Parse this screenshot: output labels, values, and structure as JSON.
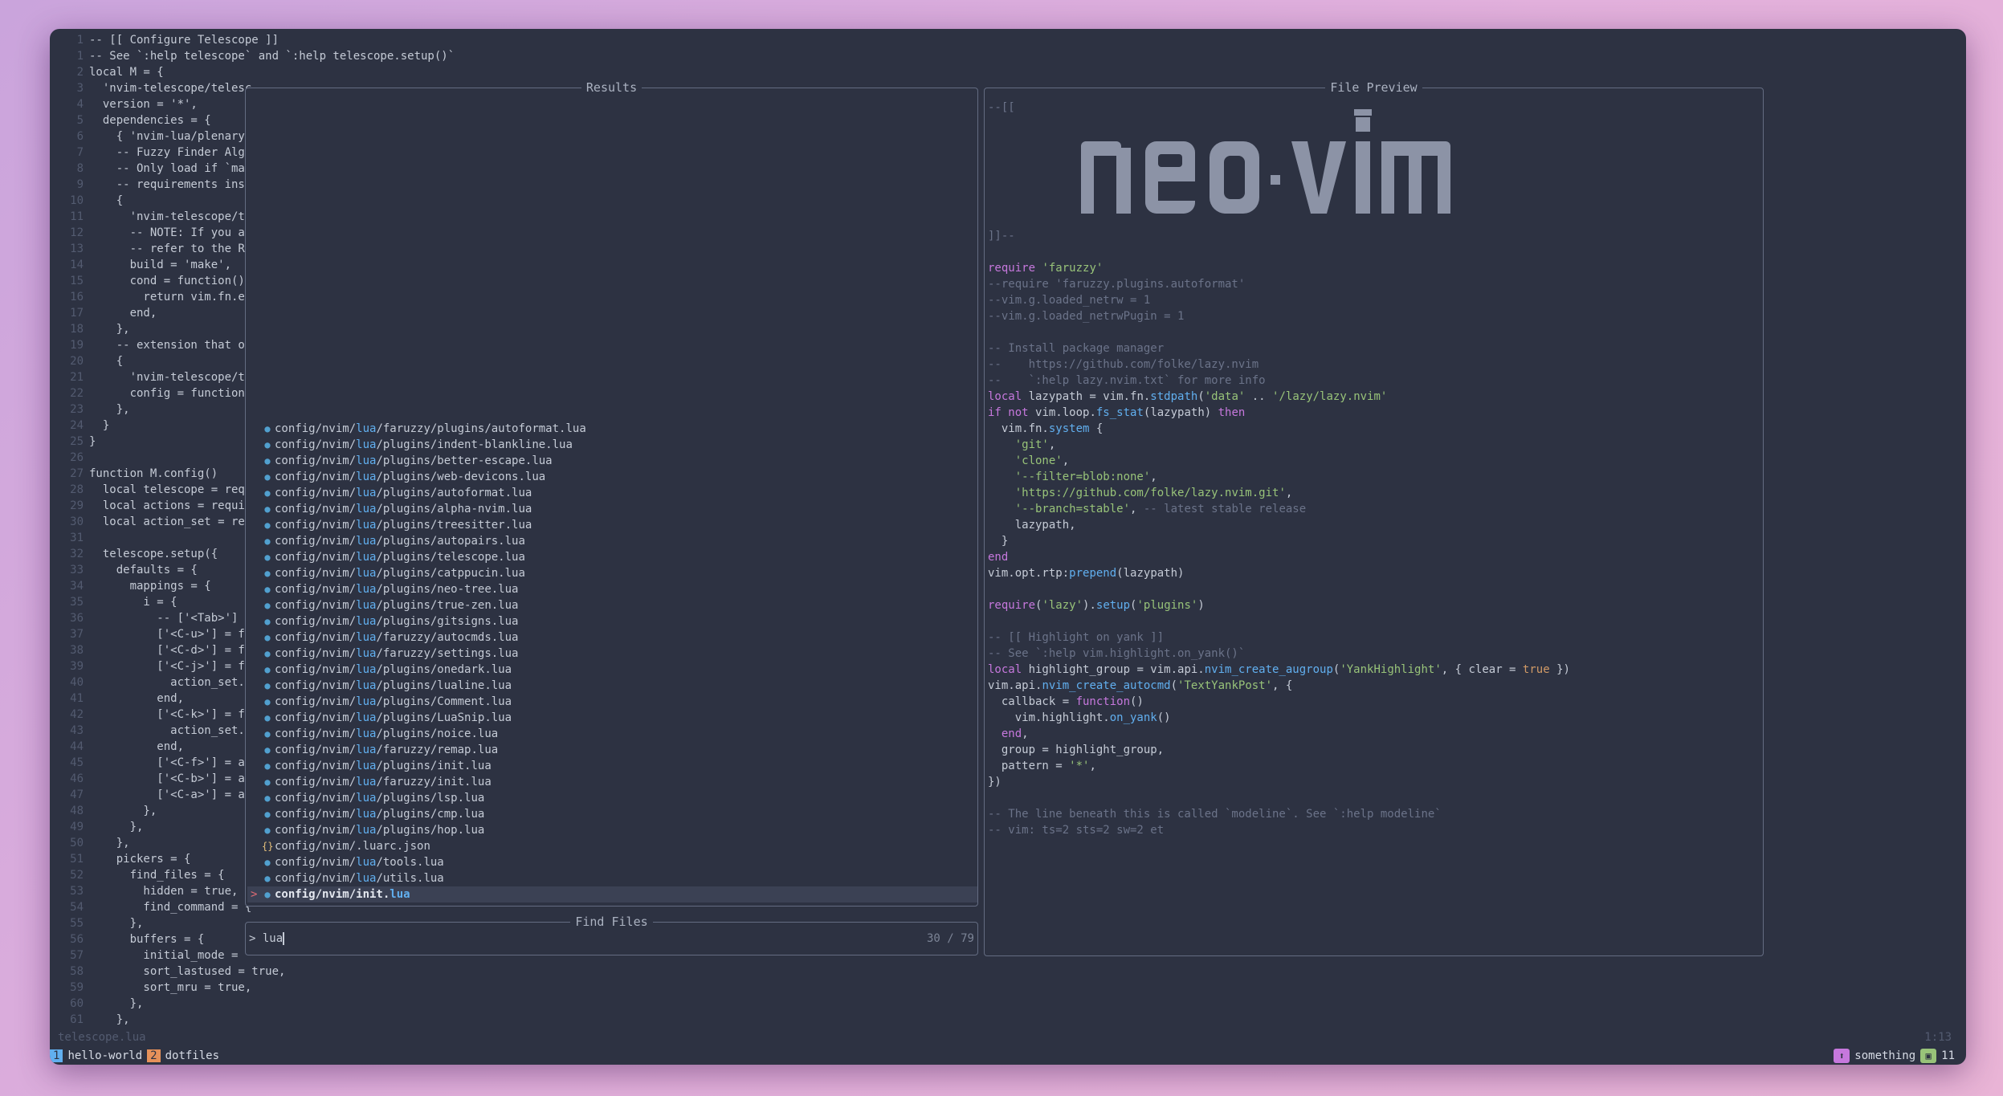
{
  "editor": {
    "file_name": "telescope.lua",
    "cursor_pos": "1:13",
    "line_numbers": "1\n1\n2\n3\n4\n5\n6\n7\n8\n9\n10\n11\n12\n13\n14\n15\n16\n17\n18\n19\n20\n21\n22\n23\n24\n25\n26\n27\n28\n29\n30\n31\n32\n33\n34\n35\n36\n37\n38\n39\n40\n41\n42\n43\n44\n45\n46\n47\n48\n49\n50\n51\n52\n53\n54\n55\n56\n57\n58\n59\n60\n61",
    "code": "-- [[ Configure Telescope ]]\n-- See `:help telescope` and `:help telescope.setup()`\nlocal M = {\n  'nvim-telescope/telesc\n  version = '*',\n  dependencies = {\n    { 'nvim-lua/plenary.\n    -- Fuzzy Finder Algo\n    -- Only load if `mak\n    -- requirements inst\n    {\n      'nvim-telescope/te\n      -- NOTE: If you ar\n      -- refer to the RE\n      build = 'make',\n      cond = function()\n        return vim.fn.ex\n      end,\n    },\n    -- extension that of\n    {\n      'nvim-telescope/te\n      config = function(\n    },\n  }\n}\n\nfunction M.config()\n  local telescope = requ\n  local actions = requir\n  local action_set = req\n\n  telescope.setup({\n    defaults = {\n      mappings = {\n        i = {\n          -- ['<Tab>'] =\n          ['<C-u>'] = fa\n          ['<C-d>'] = fa\n          ['<C-j>'] = fu\n            action_set.s\n          end,\n          ['<C-k>'] = fu\n            action_set.s\n          end,\n          ['<C-f>'] = ac\n          ['<C-b>'] = ac\n          ['<C-a>'] = ac\n        },\n      },\n    },\n    pickers = {\n      find_files = {\n        hidden = true,\n        find_command = {\n      },\n      buffers = {\n        initial_mode = '\n        sort_lastused = true,\n        sort_mru = true,\n      },\n    },"
  },
  "results": {
    "title": "Results",
    "items": [
      {
        "pre": "config/nvim/",
        "mid": "lua",
        "post": "/faruzzy/plugins/autoformat.lua",
        "icon": "lua"
      },
      {
        "pre": "config/nvim/",
        "mid": "lua",
        "post": "/plugins/indent-blankline.lua",
        "icon": "lua"
      },
      {
        "pre": "config/nvim/",
        "mid": "lua",
        "post": "/plugins/better-escape.lua",
        "icon": "lua"
      },
      {
        "pre": "config/nvim/",
        "mid": "lua",
        "post": "/plugins/web-devicons.lua",
        "icon": "lua"
      },
      {
        "pre": "config/nvim/",
        "mid": "lua",
        "post": "/plugins/autoformat.lua",
        "icon": "lua"
      },
      {
        "pre": "config/nvim/",
        "mid": "lua",
        "post": "/plugins/alpha-nvim.lua",
        "icon": "lua"
      },
      {
        "pre": "config/nvim/",
        "mid": "lua",
        "post": "/plugins/treesitter.lua",
        "icon": "lua"
      },
      {
        "pre": "config/nvim/",
        "mid": "lua",
        "post": "/plugins/autopairs.lua",
        "icon": "lua"
      },
      {
        "pre": "config/nvim/",
        "mid": "lua",
        "post": "/plugins/telescope.lua",
        "icon": "lua"
      },
      {
        "pre": "config/nvim/",
        "mid": "lua",
        "post": "/plugins/catppucin.lua",
        "icon": "lua"
      },
      {
        "pre": "config/nvim/",
        "mid": "lua",
        "post": "/plugins/neo-tree.lua",
        "icon": "lua"
      },
      {
        "pre": "config/nvim/",
        "mid": "lua",
        "post": "/plugins/true-zen.lua",
        "icon": "lua"
      },
      {
        "pre": "config/nvim/",
        "mid": "lua",
        "post": "/plugins/gitsigns.lua",
        "icon": "lua"
      },
      {
        "pre": "config/nvim/",
        "mid": "lua",
        "post": "/faruzzy/autocmds.lua",
        "icon": "lua"
      },
      {
        "pre": "config/nvim/",
        "mid": "lua",
        "post": "/faruzzy/settings.lua",
        "icon": "lua"
      },
      {
        "pre": "config/nvim/",
        "mid": "lua",
        "post": "/plugins/onedark.lua",
        "icon": "lua"
      },
      {
        "pre": "config/nvim/",
        "mid": "lua",
        "post": "/plugins/lualine.lua",
        "icon": "lua"
      },
      {
        "pre": "config/nvim/",
        "mid": "lua",
        "post": "/plugins/Comment.lua",
        "icon": "lua"
      },
      {
        "pre": "config/nvim/",
        "mid": "lua",
        "post": "/plugins/LuaSnip.lua",
        "icon": "lua"
      },
      {
        "pre": "config/nvim/",
        "mid": "lua",
        "post": "/plugins/noice.lua",
        "icon": "lua"
      },
      {
        "pre": "config/nvim/",
        "mid": "lua",
        "post": "/faruzzy/remap.lua",
        "icon": "lua"
      },
      {
        "pre": "config/nvim/",
        "mid": "lua",
        "post": "/plugins/init.lua",
        "icon": "lua"
      },
      {
        "pre": "config/nvim/",
        "mid": "lua",
        "post": "/faruzzy/init.lua",
        "icon": "lua"
      },
      {
        "pre": "config/nvim/",
        "mid": "lua",
        "post": "/plugins/lsp.lua",
        "icon": "lua"
      },
      {
        "pre": "config/nvim/",
        "mid": "lua",
        "post": "/plugins/cmp.lua",
        "icon": "lua"
      },
      {
        "pre": "config/nvim/",
        "mid": "lua",
        "post": "/plugins/hop.lua",
        "icon": "lua"
      },
      {
        "pre": "config/nvim/",
        "mid": "",
        "post": ".luarc.json",
        "icon": "json"
      },
      {
        "pre": "config/nvim/",
        "mid": "lua",
        "post": "/tools.lua",
        "icon": "lua"
      },
      {
        "pre": "config/nvim/",
        "mid": "lua",
        "post": "/utils.lua",
        "icon": "lua"
      },
      {
        "pre": "config/nvim/init.",
        "mid": "lua",
        "post": "",
        "icon": "lua",
        "selected": true
      }
    ]
  },
  "finder": {
    "title": "Find Files",
    "prompt_symbol": ">",
    "query": "lua",
    "count": "30 / 79"
  },
  "preview": {
    "title": "File Preview",
    "logo_text": "neovim",
    "lines": [
      [
        [
          "--[[",
          "cm"
        ]
      ],
      [],
      [],
      [],
      [],
      [],
      [],
      [],
      [
        [
          "]]--",
          "cm"
        ]
      ],
      [],
      [
        [
          "require ",
          "kw"
        ],
        [
          "'faruzzy'",
          "st"
        ]
      ],
      [
        [
          "--require 'faruzzy.plugins.autoformat'",
          "cm"
        ]
      ],
      [
        [
          "--vim.g.loaded_netrw = 1",
          "cm"
        ]
      ],
      [
        [
          "--vim.g.loaded_netrwPugin = 1",
          "cm"
        ]
      ],
      [],
      [
        [
          "-- Install package manager",
          "cm"
        ]
      ],
      [
        [
          "--    https://github.com/folke/lazy.nvim",
          "cm"
        ]
      ],
      [
        [
          "--    `:help lazy.nvim.txt` for more info",
          "cm"
        ]
      ],
      [
        [
          "local ",
          "kw"
        ],
        [
          "lazypath = vim.fn.",
          ""
        ],
        [
          "stdpath",
          "fn"
        ],
        [
          "(",
          ""
        ],
        [
          "'data'",
          "st"
        ],
        [
          " .. ",
          ""
        ],
        [
          "'/lazy/lazy.nvim'",
          "st"
        ]
      ],
      [
        [
          "if not ",
          "kw"
        ],
        [
          "vim.loop.",
          ""
        ],
        [
          "fs_stat",
          "fn"
        ],
        [
          "(lazypath) ",
          ""
        ],
        [
          "then",
          "kw"
        ]
      ],
      [
        [
          "  vim.fn.",
          ""
        ],
        [
          "system",
          "fn"
        ],
        [
          " {",
          ""
        ]
      ],
      [
        [
          "    ",
          ""
        ],
        [
          "'git'",
          "st"
        ],
        [
          ",",
          ""
        ]
      ],
      [
        [
          "    ",
          ""
        ],
        [
          "'clone'",
          "st"
        ],
        [
          ",",
          ""
        ]
      ],
      [
        [
          "    ",
          ""
        ],
        [
          "'--filter=blob:none'",
          "st"
        ],
        [
          ",",
          ""
        ]
      ],
      [
        [
          "    ",
          ""
        ],
        [
          "'https://github.com/folke/lazy.nvim.git'",
          "st"
        ],
        [
          ",",
          ""
        ]
      ],
      [
        [
          "    ",
          ""
        ],
        [
          "'--branch=stable'",
          "st"
        ],
        [
          ", ",
          ""
        ],
        [
          "-- latest stable release",
          "cm"
        ]
      ],
      [
        [
          "    lazypath,",
          ""
        ]
      ],
      [
        [
          "  }",
          ""
        ]
      ],
      [
        [
          "end",
          "kw"
        ]
      ],
      [
        [
          "vim.opt.rtp:",
          ""
        ],
        [
          "prepend",
          "fn"
        ],
        [
          "(lazypath)",
          ""
        ]
      ],
      [],
      [
        [
          "require",
          "kw"
        ],
        [
          "(",
          ""
        ],
        [
          "'lazy'",
          "st"
        ],
        [
          ").",
          ""
        ],
        [
          "setup",
          "fn"
        ],
        [
          "(",
          ""
        ],
        [
          "'plugins'",
          "st"
        ],
        [
          ")",
          ""
        ]
      ],
      [],
      [
        [
          "-- [[ Highlight on yank ]]",
          "cm"
        ]
      ],
      [
        [
          "-- See `:help vim.highlight.on_yank()`",
          "cm"
        ]
      ],
      [
        [
          "local ",
          "kw"
        ],
        [
          "highlight_group = vim.api.",
          ""
        ],
        [
          "nvim_create_augroup",
          "fn"
        ],
        [
          "(",
          ""
        ],
        [
          "'YankHighlight'",
          "st"
        ],
        [
          ", { clear = ",
          ""
        ],
        [
          "true",
          "bl"
        ],
        [
          " })",
          ""
        ]
      ],
      [
        [
          "vim.api.",
          ""
        ],
        [
          "nvim_create_autocmd",
          "fn"
        ],
        [
          "(",
          ""
        ],
        [
          "'TextYankPost'",
          "st"
        ],
        [
          ", {",
          ""
        ]
      ],
      [
        [
          "  callback = ",
          ""
        ],
        [
          "function",
          "kw"
        ],
        [
          "()",
          ""
        ]
      ],
      [
        [
          "    vim.highlight.",
          ""
        ],
        [
          "on_yank",
          "fn"
        ],
        [
          "()",
          ""
        ]
      ],
      [
        [
          "  ",
          ""
        ],
        [
          "end",
          "kw"
        ],
        [
          ",",
          ""
        ]
      ],
      [
        [
          "  group = highlight_group,",
          ""
        ]
      ],
      [
        [
          "  pattern = ",
          ""
        ],
        [
          "'*'",
          "st"
        ],
        [
          ",",
          ""
        ]
      ],
      [
        [
          "})",
          ""
        ]
      ],
      [],
      [
        [
          "-- The line beneath this is called `modeline`. See `:help modeline`",
          "cm"
        ]
      ],
      [
        [
          "-- vim: ts=2 sts=2 sw=2 et",
          "cm"
        ]
      ]
    ]
  },
  "tmux": {
    "windows": [
      {
        "index": "1",
        "name": "hello-world",
        "color": "#61afef"
      },
      {
        "index": "2",
        "name": "dotfiles",
        "color": "#e6915a"
      }
    ],
    "session_name": "something",
    "session_icon": "nvim-icon",
    "right_count": "11",
    "session_color": "#c678dd",
    "count_color": "#98c379"
  }
}
